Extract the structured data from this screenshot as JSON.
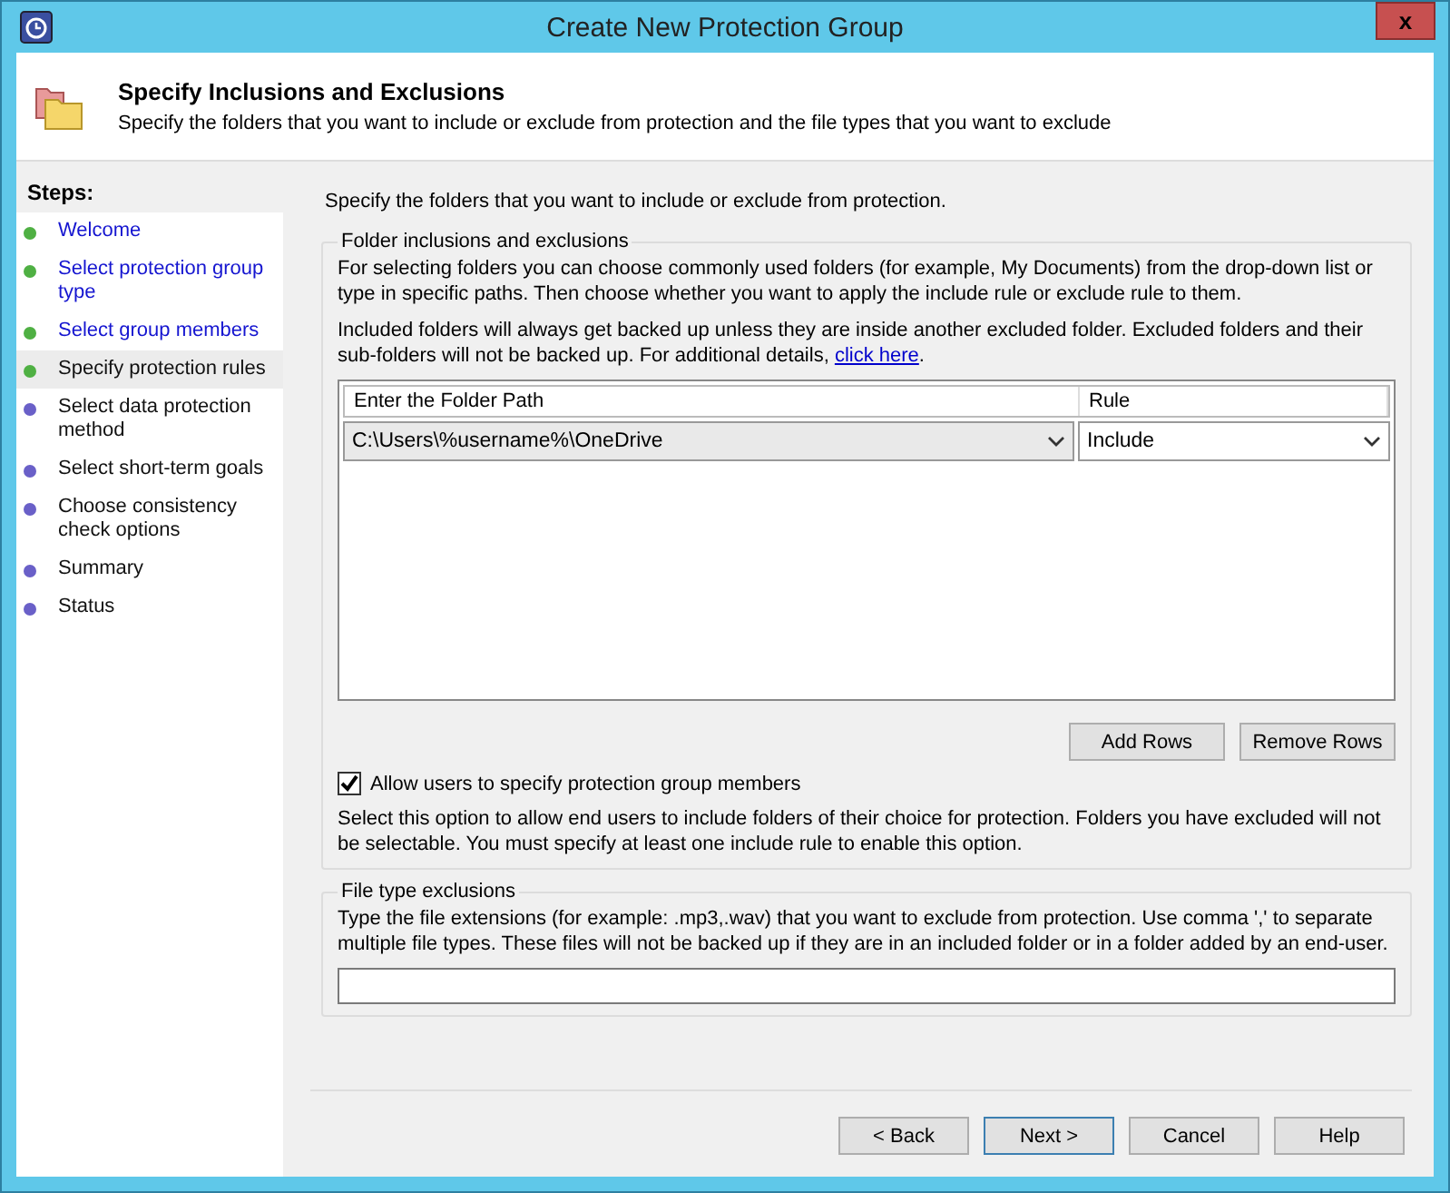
{
  "window": {
    "title": "Create New Protection Group",
    "close": "x"
  },
  "header": {
    "title": "Specify Inclusions and Exclusions",
    "subtitle": "Specify the folders that you want to include or exclude from protection and the file types that you want to exclude"
  },
  "steps": {
    "title": "Steps:",
    "items": [
      {
        "label": "Welcome",
        "done": true,
        "link": true,
        "selected": false
      },
      {
        "label": "Select protection group type",
        "done": true,
        "link": true,
        "selected": false
      },
      {
        "label": "Select group members",
        "done": true,
        "link": true,
        "selected": false
      },
      {
        "label": "Specify protection rules",
        "done": true,
        "link": false,
        "selected": true
      },
      {
        "label": "Select data protection method",
        "done": false,
        "link": false,
        "selected": false
      },
      {
        "label": "Select short-term goals",
        "done": false,
        "link": false,
        "selected": false
      },
      {
        "label": "Choose consistency check options",
        "done": false,
        "link": false,
        "selected": false
      },
      {
        "label": "Summary",
        "done": false,
        "link": false,
        "selected": false
      },
      {
        "label": "Status",
        "done": false,
        "link": false,
        "selected": false
      }
    ]
  },
  "intro": "Specify the folders that you want to include or exclude from protection.",
  "folders": {
    "legend": "Folder inclusions and exclusions",
    "text1": "For selecting folders you can choose commonly used folders (for example, My Documents) from the drop-down list or type in specific paths. Then choose whether you want to apply the include rule or exclude rule to them.",
    "text2": "Included folders will always get backed up unless they are inside another excluded folder. Excluded folders and their sub-folders will not be backed up. For additional details,",
    "link": "click here",
    "link_after": ".",
    "columns": [
      "Enter the Folder Path",
      "Rule"
    ],
    "rows": [
      {
        "path": "C:\\Users\\%username%\\OneDrive",
        "rule": "Include"
      }
    ],
    "buttons": [
      "Add Rows",
      "Remove Rows"
    ],
    "allow_users": {
      "label": "Allow users to specify protection group members",
      "checked": true
    },
    "allow_text": "Select this option to allow end users to include folders of their choice for protection. Folders you have excluded will not be selectable. You must specify at least one include rule to enable this option."
  },
  "file_types": {
    "legend": "File type exclusions",
    "text": "Type the file extensions (for example: .mp3,.wav) that you want to exclude from protection. Use comma ',' to separate multiple file types. These files will not be backed up if they are in an included folder or in a folder added by an end-user."
  },
  "footer": {
    "buttons": [
      {
        "label": "< Back",
        "default": false
      },
      {
        "label": "Next >",
        "default": true
      },
      {
        "label": "Cancel",
        "default": false
      },
      {
        "label": "Help",
        "default": false
      }
    ]
  }
}
